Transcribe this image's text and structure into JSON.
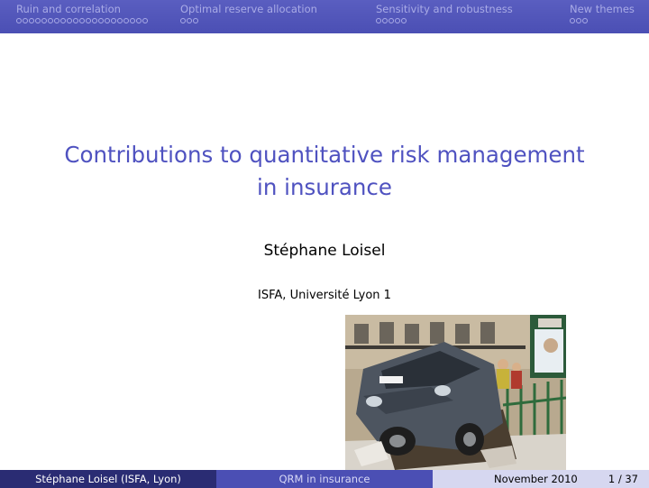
{
  "nav": {
    "sections": [
      {
        "title": "Ruin and correlation",
        "dots": 21
      },
      {
        "title": "Optimal reserve allocation",
        "dots": 3
      },
      {
        "title": "Sensitivity and robustness",
        "dots": 5
      },
      {
        "title": "New themes",
        "dots": 3
      }
    ]
  },
  "slide": {
    "title_line1": "Contributions to quantitative risk management",
    "title_line2": "in insurance",
    "author": "Stéphane Loisel",
    "institute": "ISFA, Université Lyon 1"
  },
  "footer": {
    "author_short": "Stéphane Loisel  (ISFA, Lyon)",
    "short_title": "QRM in insurance",
    "date": "November 2010",
    "page": "1 / 37"
  },
  "colors": {
    "navbar": "#4b4fb4",
    "title": "#4f52c0",
    "footer_dark": "#2a2c73",
    "footer_light": "#d6d7f0"
  }
}
